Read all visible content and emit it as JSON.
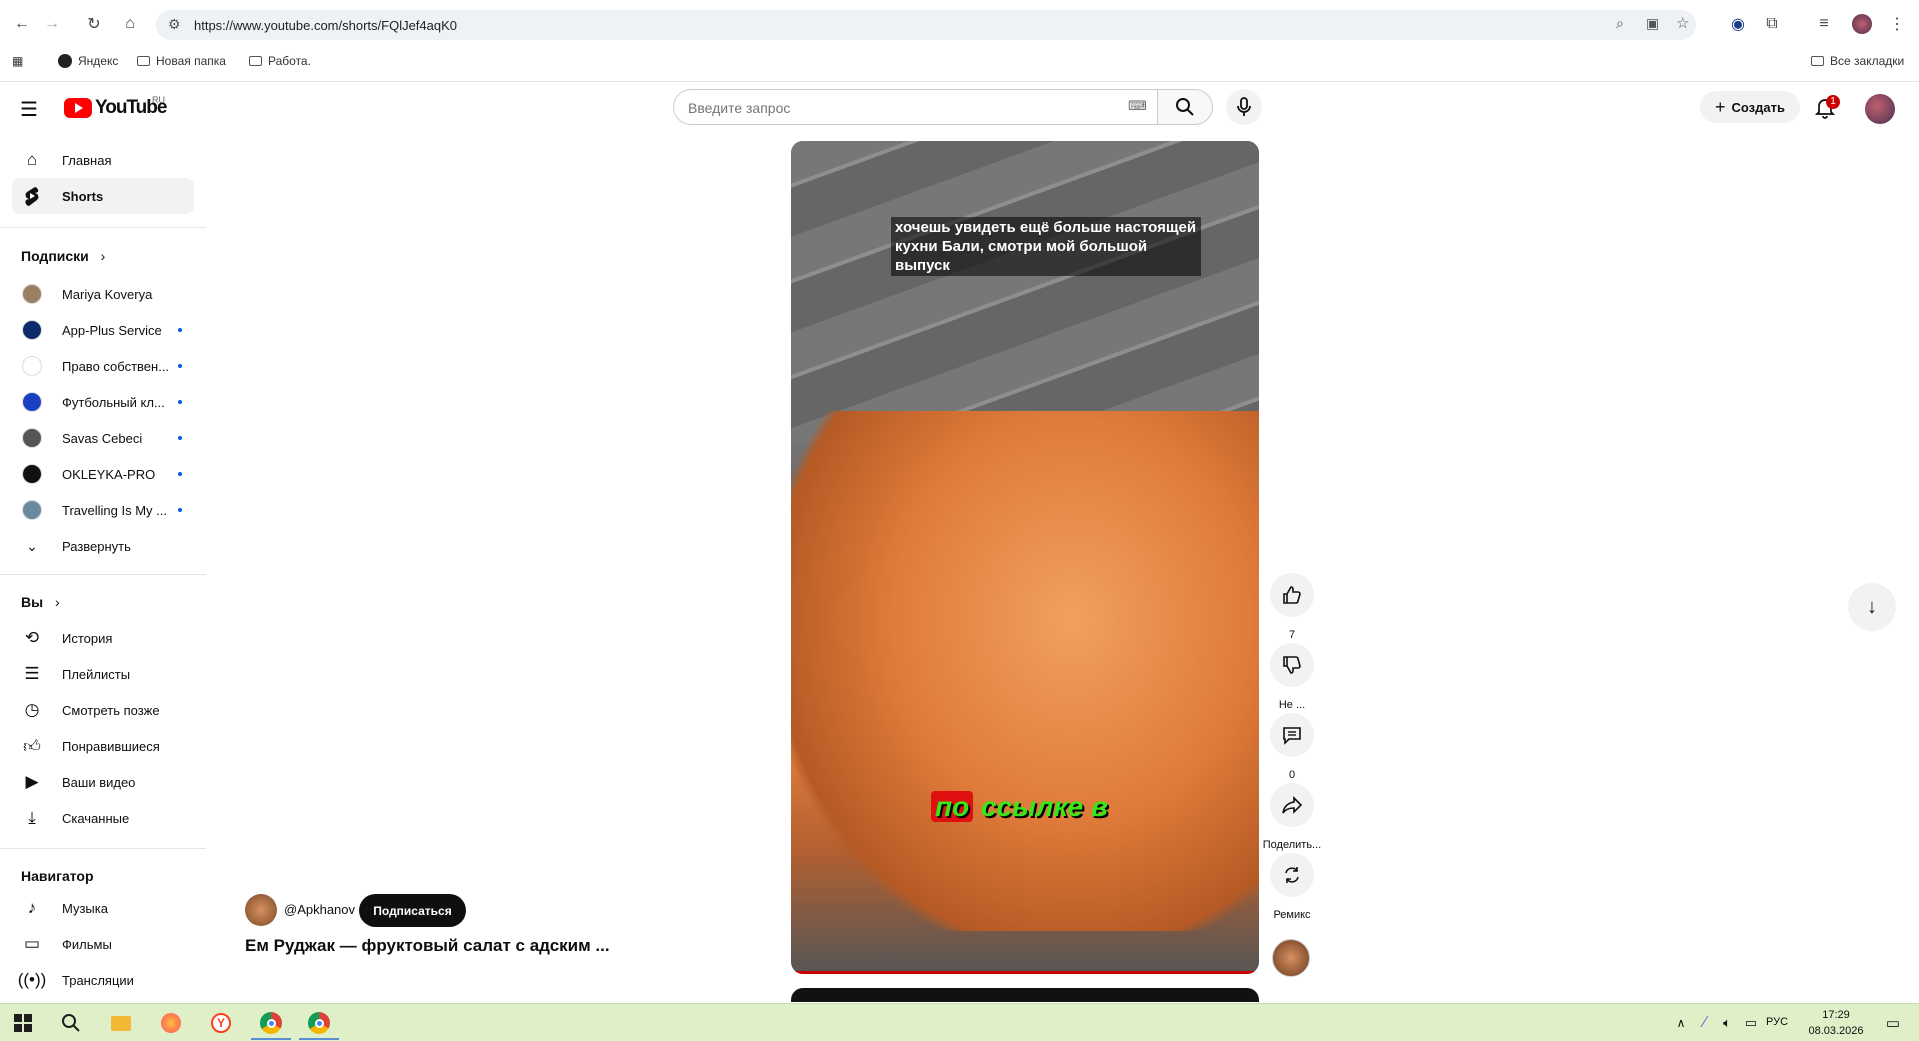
{
  "browser": {
    "url": "https://www.youtube.com/shorts/FQlJef4aqK0",
    "bookmarks": [
      "Яндекс",
      "Новая папка",
      "Работа."
    ],
    "all_bookmarks": "Все закладки"
  },
  "header": {
    "logo": "YouTube",
    "logo_region": "RU",
    "search_placeholder": "Введите запрос",
    "create_label": "Создать",
    "notifications_count": "1"
  },
  "sidebar": {
    "main": [
      {
        "label": "Главная",
        "icon": "home-icon"
      },
      {
        "label": "Shorts",
        "icon": "shorts-icon"
      }
    ],
    "subscriptions_heading": "Подписки",
    "subscriptions": [
      {
        "label": "Mariya Koverya",
        "color": "#9a8060",
        "dot": false
      },
      {
        "label": "App-Plus Service",
        "color": "#0a2a6a",
        "dot": true
      },
      {
        "label": "Право собствен...",
        "color": "#ffffff",
        "dot": true
      },
      {
        "label": "Футбольный кл...",
        "color": "#1a3fc0",
        "dot": true
      },
      {
        "label": "Savas Cebeci",
        "color": "#555555",
        "dot": true
      },
      {
        "label": "OKLEYKA-PRO",
        "color": "#111111",
        "dot": true
      },
      {
        "label": "Travelling Is My ...",
        "color": "#6a8aa0",
        "dot": true
      }
    ],
    "expand_label": "Развернуть",
    "you_heading": "Вы",
    "you": [
      {
        "label": "История",
        "icon": "history-icon"
      },
      {
        "label": "Плейлисты",
        "icon": "playlists-icon"
      },
      {
        "label": "Смотреть позже",
        "icon": "watch-later-icon"
      },
      {
        "label": "Понравившиеся",
        "icon": "liked-icon"
      },
      {
        "label": "Ваши видео",
        "icon": "your-videos-icon"
      },
      {
        "label": "Скачанные",
        "icon": "downloads-icon"
      }
    ],
    "navigator_heading": "Навигатор",
    "navigator": [
      {
        "label": "Музыка",
        "icon": "music-icon"
      },
      {
        "label": "Фильмы",
        "icon": "movies-icon"
      },
      {
        "label": "Трансляции",
        "icon": "live-icon"
      }
    ]
  },
  "short": {
    "caption_top": "хочешь увидеть ещё больше настоящей кухни Бали, смотри мой большой выпуск",
    "caption_bottom_highlight": "по",
    "caption_bottom_rest": "ссылке в",
    "channel": "@Apkhanov",
    "subscribe_label": "Подписаться",
    "title": "Ем Руджак — фруктовый салат с адским ..."
  },
  "actions": {
    "likes": "7",
    "dislike_label": "Не ...",
    "comments": "0",
    "share_label": "Поделить...",
    "remix_label": "Ремикс"
  },
  "taskbar": {
    "lang": "РУС",
    "time": "17:29",
    "date": "08.03.2026"
  }
}
